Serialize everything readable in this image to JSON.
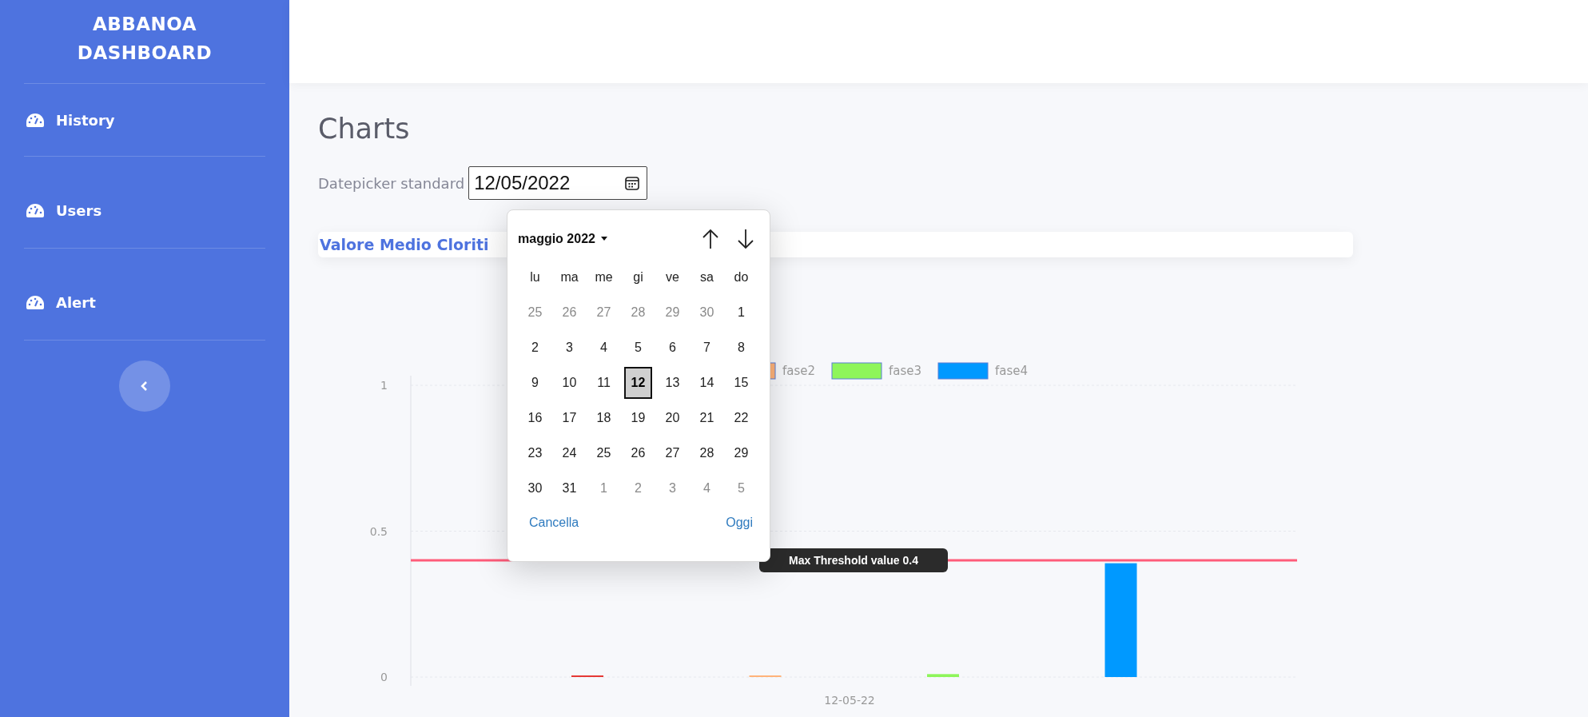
{
  "sidebar": {
    "title": "ABBANOA DASHBOARD",
    "items": [
      {
        "label": "History"
      },
      {
        "label": "Users"
      },
      {
        "label": "Alert"
      }
    ]
  },
  "page": {
    "title": "Charts",
    "datepicker": {
      "label": "Datepicker standard",
      "value": "12/05/2022"
    }
  },
  "calendar": {
    "month": "maggio 2022",
    "weekdays": [
      "lu",
      "ma",
      "me",
      "gi",
      "ve",
      "sa",
      "do"
    ],
    "days": [
      {
        "label": "25",
        "muted": true,
        "selected": false
      },
      {
        "label": "26",
        "muted": true,
        "selected": false
      },
      {
        "label": "27",
        "muted": true,
        "selected": false
      },
      {
        "label": "28",
        "muted": true,
        "selected": false
      },
      {
        "label": "29",
        "muted": true,
        "selected": false
      },
      {
        "label": "30",
        "muted": true,
        "selected": false
      },
      {
        "label": "1",
        "muted": false,
        "selected": false
      },
      {
        "label": "2",
        "muted": false,
        "selected": false
      },
      {
        "label": "3",
        "muted": false,
        "selected": false
      },
      {
        "label": "4",
        "muted": false,
        "selected": false
      },
      {
        "label": "5",
        "muted": false,
        "selected": false
      },
      {
        "label": "6",
        "muted": false,
        "selected": false
      },
      {
        "label": "7",
        "muted": false,
        "selected": false
      },
      {
        "label": "8",
        "muted": false,
        "selected": false
      },
      {
        "label": "9",
        "muted": false,
        "selected": false
      },
      {
        "label": "10",
        "muted": false,
        "selected": false
      },
      {
        "label": "11",
        "muted": false,
        "selected": false
      },
      {
        "label": "12",
        "muted": false,
        "selected": true
      },
      {
        "label": "13",
        "muted": false,
        "selected": false
      },
      {
        "label": "14",
        "muted": false,
        "selected": false
      },
      {
        "label": "15",
        "muted": false,
        "selected": false
      },
      {
        "label": "16",
        "muted": false,
        "selected": false
      },
      {
        "label": "17",
        "muted": false,
        "selected": false
      },
      {
        "label": "18",
        "muted": false,
        "selected": false
      },
      {
        "label": "19",
        "muted": false,
        "selected": false
      },
      {
        "label": "20",
        "muted": false,
        "selected": false
      },
      {
        "label": "21",
        "muted": false,
        "selected": false
      },
      {
        "label": "22",
        "muted": false,
        "selected": false
      },
      {
        "label": "23",
        "muted": false,
        "selected": false
      },
      {
        "label": "24",
        "muted": false,
        "selected": false
      },
      {
        "label": "25",
        "muted": false,
        "selected": false
      },
      {
        "label": "26",
        "muted": false,
        "selected": false
      },
      {
        "label": "27",
        "muted": false,
        "selected": false
      },
      {
        "label": "28",
        "muted": false,
        "selected": false
      },
      {
        "label": "29",
        "muted": false,
        "selected": false
      },
      {
        "label": "30",
        "muted": false,
        "selected": false
      },
      {
        "label": "31",
        "muted": false,
        "selected": false
      },
      {
        "label": "1",
        "muted": true,
        "selected": false
      },
      {
        "label": "2",
        "muted": true,
        "selected": false
      },
      {
        "label": "3",
        "muted": true,
        "selected": false
      },
      {
        "label": "4",
        "muted": true,
        "selected": false
      },
      {
        "label": "5",
        "muted": true,
        "selected": false
      }
    ],
    "clear_label": "Cancella",
    "today_label": "Oggi"
  },
  "chart_card": {
    "title": "Valore Medio Cloriti",
    "chart_data": {
      "type": "bar",
      "categories": [
        "12-05-22"
      ],
      "ylim": [
        0,
        1
      ],
      "yticks": [
        0,
        0.5,
        1
      ],
      "series": [
        {
          "color": "#e53935",
          "values": [
            0.003
          ]
        },
        {
          "name": "fase2",
          "color": "#ffb37a",
          "values": [
            0.002
          ]
        },
        {
          "name": "fase3",
          "color": "#8ef55a",
          "values": [
            0.01
          ]
        },
        {
          "name": "fase4",
          "color": "#0099ff",
          "values": [
            0.39
          ]
        }
      ],
      "legend": "top",
      "ref_lines": [
        {
          "axis": "y",
          "value": 0.4,
          "label": "Max Threshold value 0.4",
          "color": "#ff5c7a"
        }
      ]
    }
  }
}
